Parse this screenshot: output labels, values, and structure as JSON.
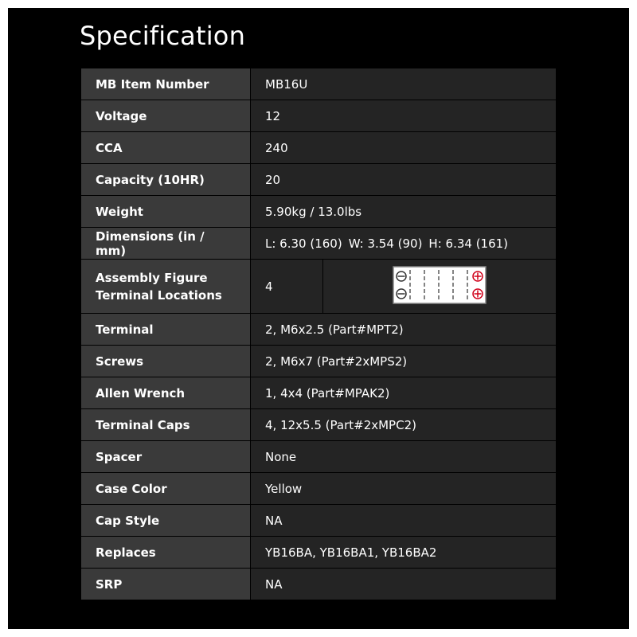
{
  "page": {
    "title": "Specification"
  },
  "specs": {
    "item_number": {
      "label": "MB Item Number",
      "value": "MB16U"
    },
    "voltage": {
      "label": "Voltage",
      "value": "12"
    },
    "cca": {
      "label": "CCA",
      "value": "240"
    },
    "capacity": {
      "label": "Capacity (10HR)",
      "value": "20"
    },
    "weight": {
      "label": "Weight",
      "value": "5.90kg / 13.0lbs"
    },
    "dimensions": {
      "label": "Dimensions (in / mm)",
      "length": "L: 6.30 (160)",
      "width": "W: 3.54 (90)",
      "height": "H: 6.34 (161)"
    },
    "assembly": {
      "label_line1": "Assembly Figure",
      "label_line2": "Terminal Locations",
      "value": "4",
      "figure_icon": "battery-terminal-diagram-icon",
      "negative_color": "#333333",
      "positive_color": "#d0021b"
    },
    "terminal": {
      "label": "Terminal",
      "value": "2, M6x2.5 (Part#MPT2)"
    },
    "screws": {
      "label": "Screws",
      "value": "2, M6x7 (Part#2xMPS2)"
    },
    "allen_wrench": {
      "label": "Allen Wrench",
      "value": "1, 4x4 (Part#MPAK2)"
    },
    "terminal_caps": {
      "label": "Terminal Caps",
      "value": "4, 12x5.5 (Part#2xMPC2)"
    },
    "spacer": {
      "label": "Spacer",
      "value": "None"
    },
    "case_color": {
      "label": "Case Color",
      "value": "Yellow"
    },
    "cap_style": {
      "label": "Cap Style",
      "value": "NA"
    },
    "replaces": {
      "label": "Replaces",
      "value": "YB16BA, YB16BA1, YB16BA2"
    },
    "srp": {
      "label": "SRP",
      "value": "NA"
    }
  }
}
